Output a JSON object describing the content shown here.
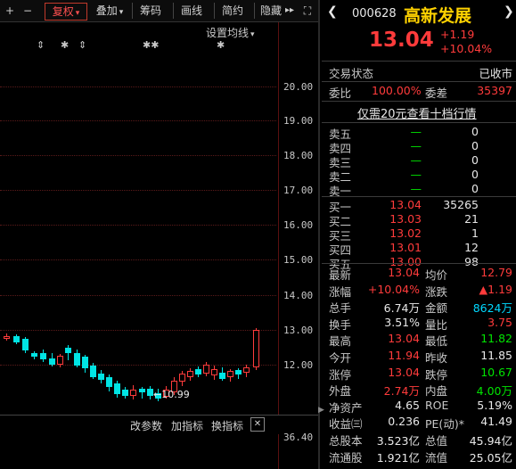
{
  "toolbar": {
    "plus": "+",
    "minus": "−",
    "fuquan": "复权",
    "fuquan_arrow": "▾",
    "overlay": "叠加",
    "overlay_arrow": "▾",
    "chouma": "筹码",
    "draw": "画线",
    "simple": "简约",
    "hide": "隐藏",
    "more": "▸▸",
    "expand": "⛶"
  },
  "chart": {
    "ma_setting": "设置均线",
    "ma_arrow": "▾",
    "price_ticks": [
      "20.00",
      "19.00",
      "18.00",
      "17.00",
      "16.00",
      "15.00",
      "14.00",
      "13.00",
      "12.00"
    ],
    "low_label": "10.99",
    "lower_tick": "36.40",
    "events": [
      "⇕",
      "✱",
      "⇕",
      "✱✱",
      "✱"
    ]
  },
  "indicator_bar": {
    "change_params": "改参数",
    "add_indicator": "加指标",
    "switch_indicator": "换指标",
    "close": "✕"
  },
  "quote": {
    "code": "000628",
    "name": "高新发展",
    "price": "13.04",
    "change": "+1.19",
    "change_pct": "+10.04%",
    "status_label": "交易状态",
    "status_value": "已收市",
    "weibi_label": "委比",
    "weibi_value": "100.00%",
    "weicha_label": "委差",
    "weicha_value": "35397",
    "level10_link": "仅需20元查看十档行情"
  },
  "order_book": {
    "asks": [
      {
        "label": "卖五",
        "price": "—",
        "vol": "0"
      },
      {
        "label": "卖四",
        "price": "—",
        "vol": "0"
      },
      {
        "label": "卖三",
        "price": "—",
        "vol": "0"
      },
      {
        "label": "卖二",
        "price": "—",
        "vol": "0"
      },
      {
        "label": "卖一",
        "price": "—",
        "vol": "0"
      }
    ],
    "bids": [
      {
        "label": "买一",
        "price": "13.04",
        "vol": "35265"
      },
      {
        "label": "买二",
        "price": "13.03",
        "vol": "21"
      },
      {
        "label": "买三",
        "price": "13.02",
        "vol": "1"
      },
      {
        "label": "买四",
        "price": "13.01",
        "vol": "12"
      },
      {
        "label": "买五",
        "price": "13.00",
        "vol": "98"
      }
    ]
  },
  "stats": [
    {
      "l1": "最新",
      "v1": "13.04",
      "c1": "red",
      "l2": "均价",
      "v2": "12.79",
      "c2": "red"
    },
    {
      "l1": "涨幅",
      "v1": "+10.04%",
      "c1": "red",
      "l2": "涨跌",
      "v2": "▲1.19",
      "c2": "red"
    },
    {
      "l1": "总手",
      "v1": "6.74万",
      "c1": "white",
      "l2": "金额",
      "v2": "8624万",
      "c2": "cyan"
    },
    {
      "l1": "换手",
      "v1": "3.51%",
      "c1": "white",
      "l2": "量比",
      "v2": "3.75",
      "c2": "red"
    },
    {
      "l1": "最高",
      "v1": "13.04",
      "c1": "red",
      "l2": "最低",
      "v2": "11.82",
      "c2": "green"
    },
    {
      "l1": "今开",
      "v1": "11.94",
      "c1": "red",
      "l2": "昨收",
      "v2": "11.85",
      "c2": "white"
    },
    {
      "l1": "涨停",
      "v1": "13.04",
      "c1": "red",
      "l2": "跌停",
      "v2": "10.67",
      "c2": "green"
    },
    {
      "l1": "外盘",
      "v1": "2.74万",
      "c1": "red",
      "l2": "内盘",
      "v2": "4.00万",
      "c2": "green"
    },
    {
      "l1": "净资产",
      "v1": "4.65",
      "c1": "white",
      "l2": "ROE",
      "v2": "5.19%",
      "c2": "white"
    },
    {
      "l1": "收益㈢",
      "v1": "0.236",
      "c1": "white",
      "l2": "PE(动)*",
      "v2": "41.49",
      "c2": "white"
    },
    {
      "l1": "总股本",
      "v1": "3.523亿",
      "c1": "white",
      "l2": "总值",
      "v2": "45.94亿",
      "c2": "white"
    },
    {
      "l1": "流通股",
      "v1": "1.921亿",
      "c1": "white",
      "l2": "流值",
      "v2": "25.05亿",
      "c2": "white"
    }
  ],
  "colors": {
    "up": "#ff3b3b",
    "down": "#00e4e4",
    "bg": "#000000",
    "accent": "#c0392b"
  }
}
